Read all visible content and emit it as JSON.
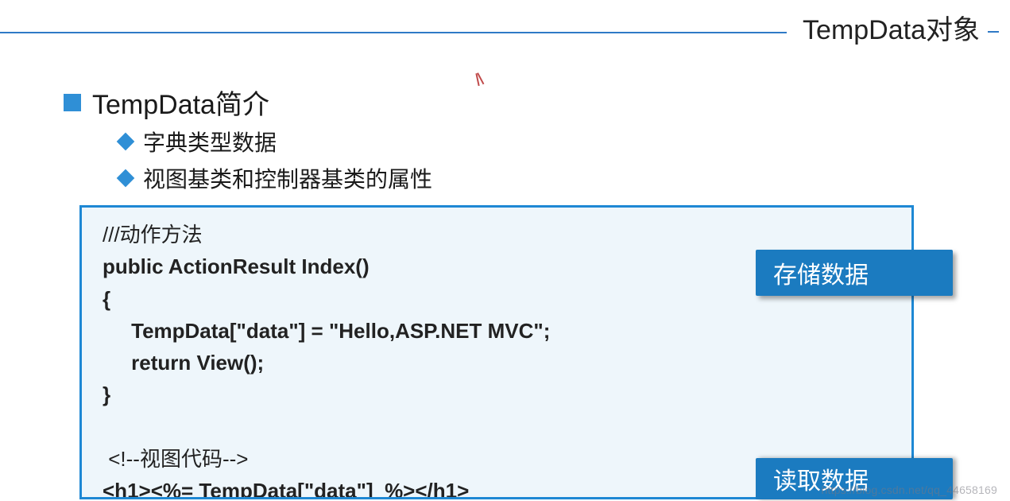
{
  "top_title": "TempData对象",
  "heading": "TempData简介",
  "bullets": [
    "字典类型数据",
    "视图基类和控制器基类的属性"
  ],
  "code": {
    "line1_comment": "///动作方法",
    "line2": "public ActionResult Index()",
    "line3": "{",
    "line4": "     TempData[\"data\"] = \"Hello,ASP.NET MVC\";",
    "line5": "     return View();",
    "line6": "}",
    "line7": "",
    "line8_comment": " <!--视图代码-->",
    "line9": "<h1><%= TempData[\"data\"]  %></h1>"
  },
  "badges": {
    "store": "存储数据",
    "read": "读取数据"
  },
  "watermark": "https://blog.csdn.net/qq_44658169"
}
